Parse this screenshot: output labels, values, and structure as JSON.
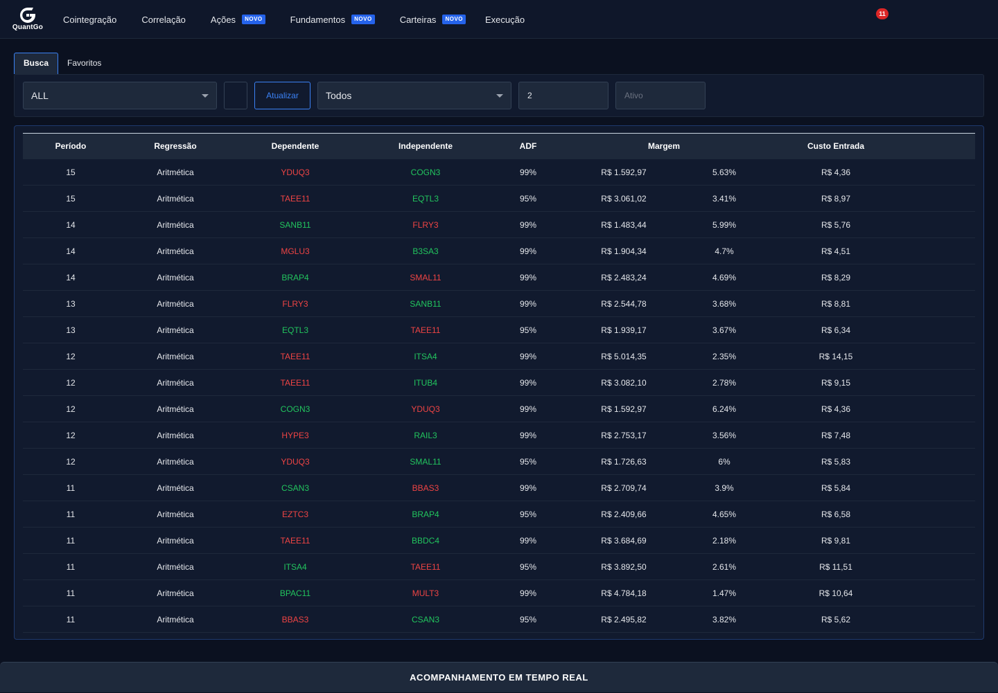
{
  "brand": {
    "name": "QuantGo"
  },
  "nav": [
    {
      "label": "Cointegração",
      "badge": ""
    },
    {
      "label": "Correlação",
      "badge": ""
    },
    {
      "label": "Ações",
      "badge": "NOVO"
    },
    {
      "label": "Fundamentos",
      "badge": "NOVO"
    },
    {
      "label": "Carteiras",
      "badge": "NOVO"
    },
    {
      "label": "Execução",
      "badge": ""
    }
  ],
  "notifications": {
    "count": "11"
  },
  "tabs": [
    {
      "label": "Busca",
      "active": true
    },
    {
      "label": "Favoritos",
      "active": false
    }
  ],
  "filters": {
    "market_select": "ALL",
    "update_label": "Atualizar",
    "type_select": "Todos",
    "number_value": "2",
    "asset_placeholder": "Ativo"
  },
  "table": {
    "headers": [
      "Período",
      "Regressão",
      "Dependente",
      "Independente",
      "ADF",
      "Margem",
      "Custo Entrada"
    ],
    "rows": [
      {
        "periodo": "15",
        "regressao": "Aritmética",
        "dependente": "YDUQ3",
        "dep_color": "red",
        "independente": "COGN3",
        "ind_color": "green",
        "adf": "99%",
        "margem": "R$ 1.592,97",
        "margem_pct": "5.63%",
        "custo": "R$ 4,36"
      },
      {
        "periodo": "15",
        "regressao": "Aritmética",
        "dependente": "TAEE11",
        "dep_color": "red",
        "independente": "EQTL3",
        "ind_color": "green",
        "adf": "95%",
        "margem": "R$ 3.061,02",
        "margem_pct": "3.41%",
        "custo": "R$ 8,97"
      },
      {
        "periodo": "14",
        "regressao": "Aritmética",
        "dependente": "SANB11",
        "dep_color": "green",
        "independente": "FLRY3",
        "ind_color": "red",
        "adf": "99%",
        "margem": "R$ 1.483,44",
        "margem_pct": "5.99%",
        "custo": "R$ 5,76"
      },
      {
        "periodo": "14",
        "regressao": "Aritmética",
        "dependente": "MGLU3",
        "dep_color": "red",
        "independente": "B3SA3",
        "ind_color": "green",
        "adf": "99%",
        "margem": "R$ 1.904,34",
        "margem_pct": "4.7%",
        "custo": "R$ 4,51"
      },
      {
        "periodo": "14",
        "regressao": "Aritmética",
        "dependente": "BRAP4",
        "dep_color": "green",
        "independente": "SMAL11",
        "ind_color": "red",
        "adf": "99%",
        "margem": "R$ 2.483,24",
        "margem_pct": "4.69%",
        "custo": "R$ 8,29"
      },
      {
        "periodo": "13",
        "regressao": "Aritmética",
        "dependente": "FLRY3",
        "dep_color": "red",
        "independente": "SANB11",
        "ind_color": "green",
        "adf": "99%",
        "margem": "R$ 2.544,78",
        "margem_pct": "3.68%",
        "custo": "R$ 8,81"
      },
      {
        "periodo": "13",
        "regressao": "Aritmética",
        "dependente": "EQTL3",
        "dep_color": "green",
        "independente": "TAEE11",
        "ind_color": "red",
        "adf": "95%",
        "margem": "R$ 1.939,17",
        "margem_pct": "3.67%",
        "custo": "R$ 6,34"
      },
      {
        "periodo": "12",
        "regressao": "Aritmética",
        "dependente": "TAEE11",
        "dep_color": "red",
        "independente": "ITSA4",
        "ind_color": "green",
        "adf": "99%",
        "margem": "R$ 5.014,35",
        "margem_pct": "2.35%",
        "custo": "R$ 14,15"
      },
      {
        "periodo": "12",
        "regressao": "Aritmética",
        "dependente": "TAEE11",
        "dep_color": "red",
        "independente": "ITUB4",
        "ind_color": "green",
        "adf": "99%",
        "margem": "R$ 3.082,10",
        "margem_pct": "2.78%",
        "custo": "R$ 9,15"
      },
      {
        "periodo": "12",
        "regressao": "Aritmética",
        "dependente": "COGN3",
        "dep_color": "green",
        "independente": "YDUQ3",
        "ind_color": "red",
        "adf": "99%",
        "margem": "R$ 1.592,97",
        "margem_pct": "6.24%",
        "custo": "R$ 4,36"
      },
      {
        "periodo": "12",
        "regressao": "Aritmética",
        "dependente": "HYPE3",
        "dep_color": "red",
        "independente": "RAIL3",
        "ind_color": "green",
        "adf": "99%",
        "margem": "R$ 2.753,17",
        "margem_pct": "3.56%",
        "custo": "R$ 7,48"
      },
      {
        "periodo": "12",
        "regressao": "Aritmética",
        "dependente": "YDUQ3",
        "dep_color": "red",
        "independente": "SMAL11",
        "ind_color": "green",
        "adf": "95%",
        "margem": "R$ 1.726,63",
        "margem_pct": "6%",
        "custo": "R$ 5,83"
      },
      {
        "periodo": "11",
        "regressao": "Aritmética",
        "dependente": "CSAN3",
        "dep_color": "green",
        "independente": "BBAS3",
        "ind_color": "red",
        "adf": "99%",
        "margem": "R$ 2.709,74",
        "margem_pct": "3.9%",
        "custo": "R$ 5,84"
      },
      {
        "periodo": "11",
        "regressao": "Aritmética",
        "dependente": "EZTC3",
        "dep_color": "red",
        "independente": "BRAP4",
        "ind_color": "green",
        "adf": "95%",
        "margem": "R$ 2.409,66",
        "margem_pct": "4.65%",
        "custo": "R$ 6,58"
      },
      {
        "periodo": "11",
        "regressao": "Aritmética",
        "dependente": "TAEE11",
        "dep_color": "red",
        "independente": "BBDC4",
        "ind_color": "green",
        "adf": "99%",
        "margem": "R$ 3.684,69",
        "margem_pct": "2.18%",
        "custo": "R$ 9,81"
      },
      {
        "periodo": "11",
        "regressao": "Aritmética",
        "dependente": "ITSA4",
        "dep_color": "green",
        "independente": "TAEE11",
        "ind_color": "red",
        "adf": "95%",
        "margem": "R$ 3.892,50",
        "margem_pct": "2.61%",
        "custo": "R$ 11,51"
      },
      {
        "periodo": "11",
        "regressao": "Aritmética",
        "dependente": "BPAC11",
        "dep_color": "green",
        "independente": "MULT3",
        "ind_color": "red",
        "adf": "99%",
        "margem": "R$ 4.784,18",
        "margem_pct": "1.47%",
        "custo": "R$ 10,64"
      },
      {
        "periodo": "11",
        "regressao": "Aritmética",
        "dependente": "BBAS3",
        "dep_color": "red",
        "independente": "CSAN3",
        "ind_color": "green",
        "adf": "95%",
        "margem": "R$ 2.495,82",
        "margem_pct": "3.82%",
        "custo": "R$ 5,62"
      }
    ]
  },
  "footer": {
    "label": "ACOMPANHAMENTO EM TEMPO REAL"
  },
  "colors": {
    "gain": "#22c55e",
    "loss": "#ef4444",
    "accent": "#3b82f6",
    "badge": "#2563eb"
  },
  "icons": {
    "logo": "quantgo-logo-icon",
    "dropdown": "chevron-down-icon"
  }
}
